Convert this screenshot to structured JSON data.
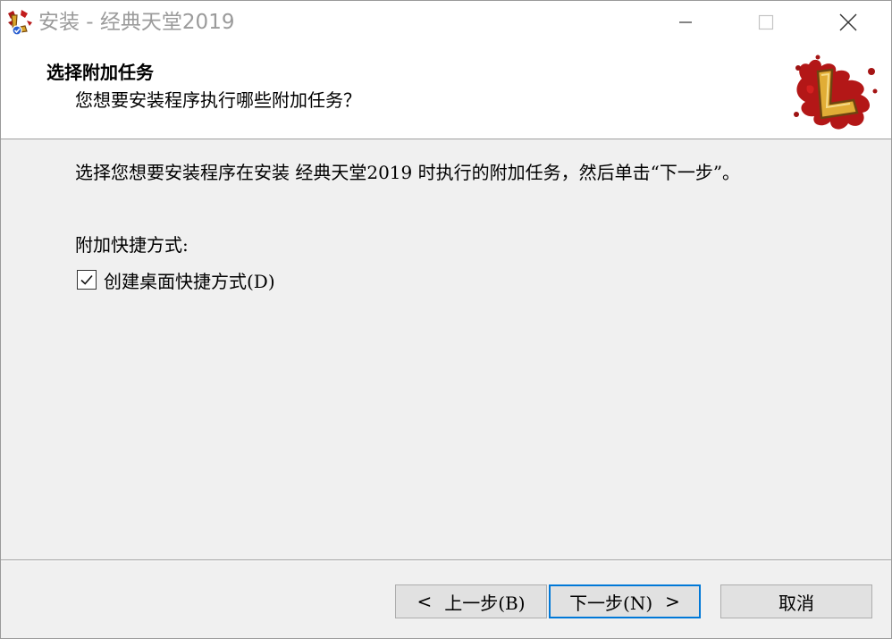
{
  "window": {
    "title": "安装 - 经典天堂2019",
    "icon": "app-logo-icon",
    "controls": {
      "minimize_icon": "minimize-icon",
      "maximize_icon": "maximize-icon",
      "close_icon": "close-icon"
    }
  },
  "header": {
    "title": "选择附加任务",
    "subtitle": "您想要安装程序执行哪些附加任务？",
    "logo": "game-logo-icon"
  },
  "content": {
    "description": "选择您想要安装程序在安装 经典天堂2019 时执行的附加任务，然后单击“下一步”。",
    "group_label": "附加快捷方式:",
    "tasks": [
      {
        "label": "创建桌面快捷方式(D)",
        "checked": true
      }
    ]
  },
  "buttons": {
    "back": "上一步(B)",
    "back_chevron": "<",
    "next": "下一步(N)",
    "next_chevron": ">",
    "cancel": "取消"
  },
  "colors": {
    "accent": "#0078d7",
    "title_gray": "#9b9b9b",
    "background": "#f0f0f0",
    "button": "#e1e1e1"
  }
}
